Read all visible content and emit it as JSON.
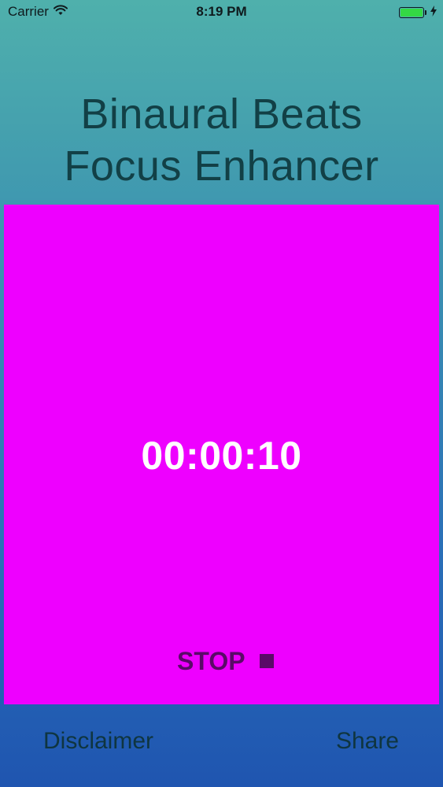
{
  "status_bar": {
    "carrier": "Carrier",
    "time": "8:19 PM",
    "battery_level": 1.0,
    "icons": [
      "wifi-icon",
      "battery-icon",
      "charging-bolt-icon"
    ]
  },
  "app": {
    "title_line1": "Binaural Beats",
    "title_line2": "Focus Enhancer"
  },
  "timer": {
    "display": "00:00:10",
    "stop_label": "STOP",
    "stop_icon": "stop-square-icon",
    "panel_color": "#ee00ff"
  },
  "bottom_bar": {
    "disclaimer_label": "Disclaimer",
    "share_label": "Share"
  }
}
